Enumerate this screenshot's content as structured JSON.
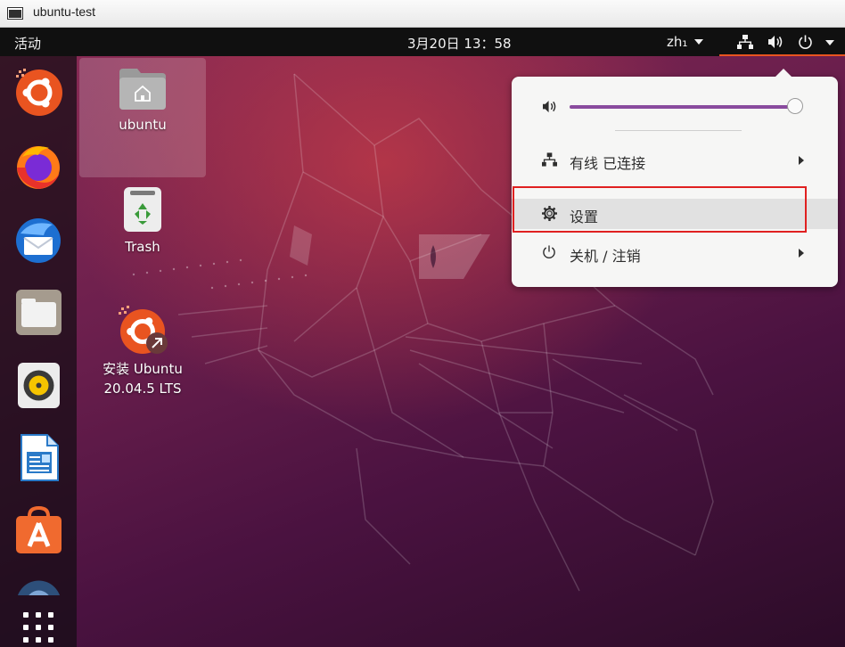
{
  "vm_window": {
    "title": "ubuntu-test",
    "icon": "vm-window-icon"
  },
  "topbar": {
    "activities": "活动",
    "clock": "3月20日  13：58",
    "input_method": "zh₁",
    "status_icons": [
      "network-wired-icon",
      "volume-icon",
      "power-icon"
    ],
    "accent_color": "#e95420"
  },
  "dock": {
    "items": [
      {
        "name": "ubuntu-logo-icon"
      },
      {
        "name": "firefox-icon"
      },
      {
        "name": "thunderbird-icon"
      },
      {
        "name": "files-icon"
      },
      {
        "name": "rhythmbox-icon"
      },
      {
        "name": "libreoffice-writer-icon"
      },
      {
        "name": "ubuntu-software-icon"
      },
      {
        "name": "help-icon"
      }
    ],
    "show_apps": "show-applications-icon"
  },
  "desktop": {
    "icons": [
      {
        "label": "ubuntu",
        "icon": "home-folder-icon",
        "selected": true
      },
      {
        "label": "Trash",
        "icon": "trash-icon"
      },
      {
        "label": "安装 Ubuntu 20.04.5 LTS",
        "label_line1": "安装 Ubuntu",
        "label_line2": "20.04.5 LTS",
        "icon": "ubuntu-installer-icon"
      }
    ]
  },
  "system_menu": {
    "volume": {
      "icon": "volume-icon",
      "level": 0.98
    },
    "items": [
      {
        "label": "有线 已连接",
        "icon": "network-wired-icon",
        "has_submenu": true
      },
      {
        "label": "设置",
        "icon": "settings-icon",
        "has_submenu": false,
        "highlighted": true
      },
      {
        "label": "关机 / 注销",
        "icon": "power-icon",
        "has_submenu": true
      }
    ],
    "slider_color": "#8a4b9e"
  },
  "annotation": {
    "highlight_color": "#e02020"
  }
}
